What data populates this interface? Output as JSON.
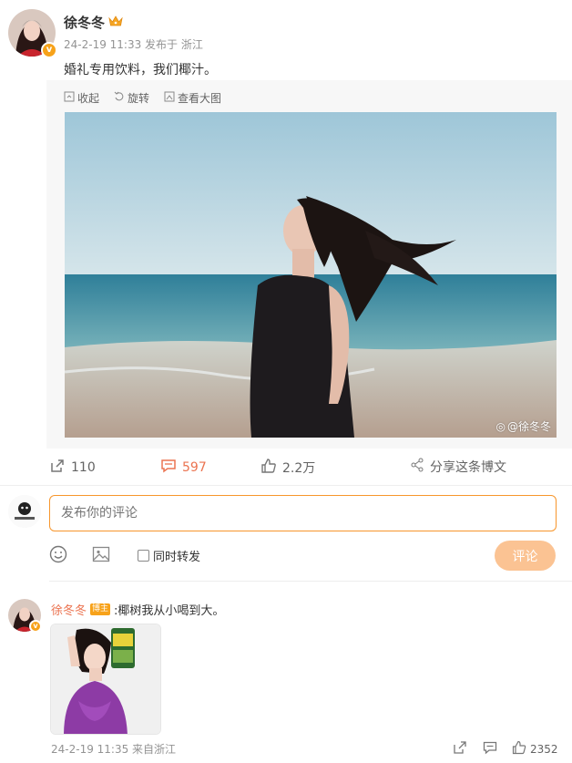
{
  "post": {
    "author": "徐冬冬",
    "meta": "24-2-19 11:33 发布于 浙江",
    "text": "婚礼专用饮料，我们椰汁。",
    "image_tools": {
      "collect": "收起",
      "rotate": "旋转",
      "view_large": "查看大图"
    },
    "watermark": "@徐冬冬"
  },
  "actions": {
    "reposts": "110",
    "comments": "597",
    "likes": "2.2万",
    "share": "分享这条博文"
  },
  "composer": {
    "placeholder": "发布你的评论",
    "repost_label": "同时转发",
    "submit": "评论"
  },
  "comment": {
    "author": "徐冬冬",
    "badge": "博主",
    "text": ":椰树我从小喝到大。",
    "meta": "24-2-19 11:35 来自浙江",
    "likes": "2352"
  },
  "colors": {
    "accent": "#f7962c",
    "link": "#eb7350",
    "verified": "#f7a21a"
  },
  "icons": [
    "crown-icon",
    "collect-icon",
    "rotate-icon",
    "view-large-icon",
    "repost-icon",
    "comment-icon",
    "like-icon",
    "share-icon",
    "emoji-icon",
    "image-icon"
  ]
}
